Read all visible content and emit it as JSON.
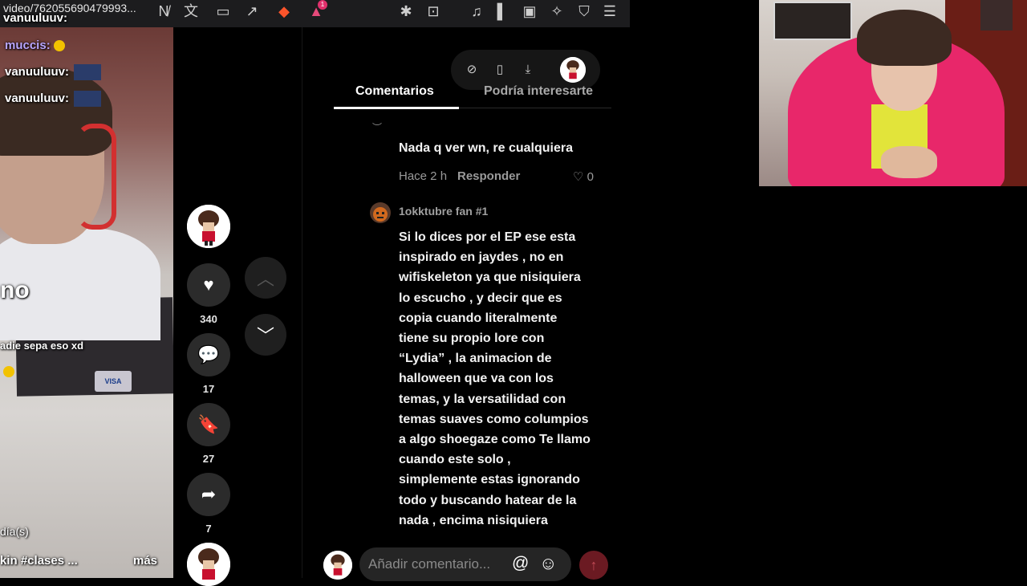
{
  "browser": {
    "url_text": "video/762055690479993...",
    "badge_count": "1"
  },
  "stream_chat": {
    "messages": [
      {
        "user": "vanuuluuv:",
        "color": "#ffffff"
      },
      {
        "user": "muccis:",
        "color": "#b9a6ff"
      },
      {
        "user": "vanuuluuv:",
        "color": "#ffffff"
      },
      {
        "user": "vanuuluuv:",
        "color": "#ffffff"
      }
    ],
    "overlay_word": "no",
    "overlay_caption": "adie sepa eso xd",
    "card_label": "VISA",
    "bottom_left_1": "día(s)",
    "bottom_left_2": "kin #clases ...",
    "bottom_right": "más"
  },
  "actions": {
    "likes": "340",
    "comments": "17",
    "saves": "27",
    "shares": "7"
  },
  "panel": {
    "tabs": [
      "Comentarios",
      "Podría interesarte"
    ],
    "comments": [
      {
        "text": "Nada q ver wn, re cualquiera",
        "time": "Hace 2 h",
        "reply": "Responder",
        "likes": "0"
      },
      {
        "author": "1okktubre fan #1",
        "lines": [
          "Si lo dices por el EP ese esta",
          "inspirado en jaydes , no en",
          "wifiskeleton ya que nisiquiera",
          "lo escucho , y decir que es",
          "copia cuando literalmente",
          "tiene su propio lore con",
          "“Lydia” , la animacion de",
          "halloween que va con los",
          "temas, y la versatilidad con",
          "temas suaves como columpios",
          "a algo shoegaze como Te llamo",
          "cuando este solo ,",
          "simplemente estas ignorando",
          "todo y buscando hatear de la",
          "nada , encima nisiquiera"
        ]
      }
    ],
    "input_placeholder": "Añadir comentario...",
    "mention_symbol": "@",
    "emoji_symbol": "☺"
  },
  "colors": {
    "accent": "#fe2c55",
    "tab_underline": "#ffffff",
    "hood": "#e8276a"
  }
}
